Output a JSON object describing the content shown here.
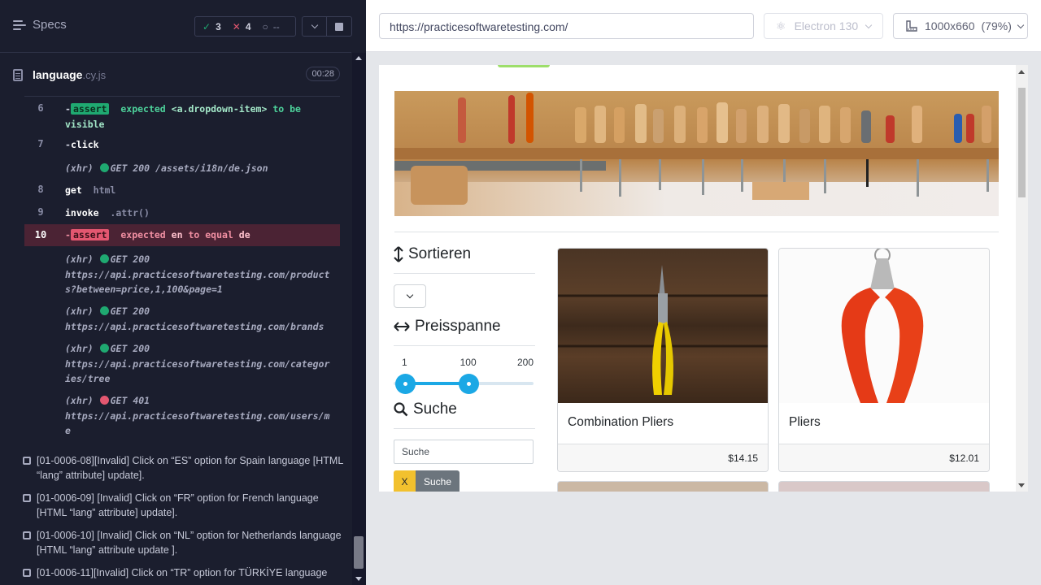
{
  "reporter": {
    "specs_label": "Specs",
    "stats": {
      "passed": "3",
      "failed": "4",
      "pending": "--"
    },
    "spec_name": "language",
    "spec_ext": ".cy.js",
    "duration": "00:28",
    "commands": [
      {
        "num": "6",
        "name": "assert",
        "text": {
          "k1": "expected",
          "v1": "<a.dropdown-item>",
          "k2": "to be",
          "k3": "visible"
        }
      },
      {
        "num": "7",
        "name": "click"
      },
      {
        "num": "",
        "xhr": "(xhr)",
        "method": "GET 200",
        "url": "/assets/i18n/de.json"
      },
      {
        "num": "8",
        "name": "get",
        "arg": "html"
      },
      {
        "num": "9",
        "name": "invoke",
        "arg": ".attr()"
      },
      {
        "num": "10",
        "name": "assert",
        "text": {
          "k1": "expected",
          "v1": "en",
          "k2": "to equal",
          "v2": "de"
        }
      },
      {
        "num": "",
        "xhr": "(xhr)",
        "method": "GET 200",
        "url_l1": "https://api.practicesoftwaretesting.com/product",
        "url_l2": "s?between=price,1,100&page=1"
      },
      {
        "num": "",
        "xhr": "(xhr)",
        "method": "GET 200",
        "url_l1": "https://api.practicesoftwaretesting.com/brands"
      },
      {
        "num": "",
        "xhr": "(xhr)",
        "method": "GET 200",
        "url_l1": "https://api.practicesoftwaretesting.com/categor",
        "url_l2": "ies/tree"
      },
      {
        "num": "",
        "xhr": "(xhr)",
        "method": "GET 401",
        "url_l1": "https://api.practicesoftwaretesting.com/users/m",
        "url_l2": "e"
      }
    ],
    "tests": [
      "[01-0006-08][Invalid] Click on “ES” option for Spain language [HTML “lang” attribute] update].",
      "[01-0006-09] [Invalid] Click on “FR” option for French language [HTML “lang” attribute] update].",
      "[01-0006-10] [Invalid] Click on “NL” option for Netherlands language [HTML “lang” attribute update ].",
      "[01-0006-11][Invalid] Click on “TR” option for TÜRKİYE language"
    ]
  },
  "preview": {
    "url": "https://practicesoftwaretesting.com/",
    "browser": "Electron 130",
    "viewport": "1000x660",
    "scale": "(79%)"
  },
  "app": {
    "sort_heading": "Sortieren",
    "price_heading": "Preisspanne",
    "price_min_label": "1",
    "price_sel_label": "100",
    "price_max_label": "200",
    "price_range": {
      "min": 1,
      "max": 200,
      "low": 1,
      "high": 100
    },
    "search_heading": "Suche",
    "search_placeholder": "Suche",
    "btn_x": "X",
    "btn_search": "Suche",
    "products": [
      {
        "name": "Combination Pliers",
        "price": "$14.15"
      },
      {
        "name": "Pliers",
        "price": "$12.01"
      }
    ]
  },
  "colors": {
    "pass": "#1fa971",
    "fail": "#e45770",
    "accent": "#1ba8e5",
    "reporter_bg": "#1b1e2e"
  }
}
